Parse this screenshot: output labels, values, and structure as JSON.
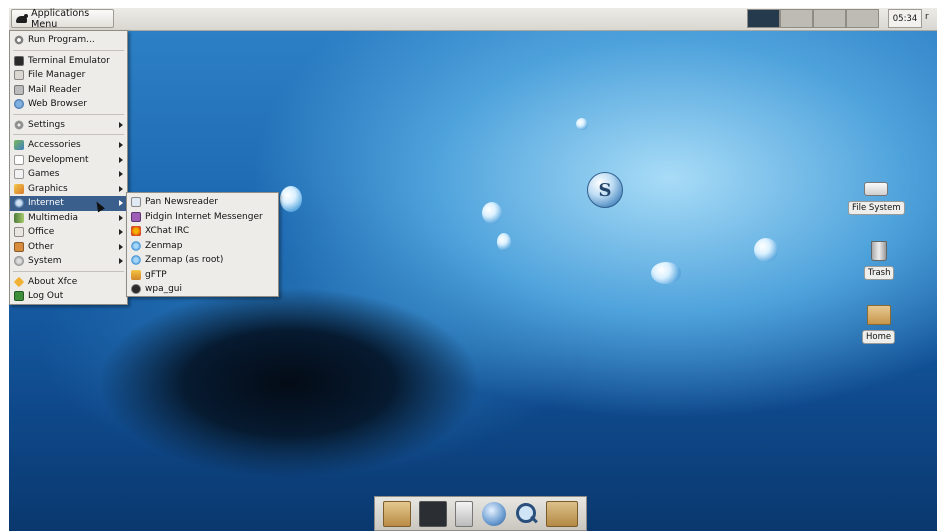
{
  "panel": {
    "apps_menu_label": "Applications Menu",
    "clock": "05:34",
    "user_clip": "r"
  },
  "main_menu": {
    "items": [
      {
        "label": "Run Program...",
        "icon": "run-icon"
      },
      {
        "label": "Terminal Emulator",
        "icon": "terminal-icon"
      },
      {
        "label": "File Manager",
        "icon": "file-manager-icon"
      },
      {
        "label": "Mail Reader",
        "icon": "mail-icon"
      },
      {
        "label": "Web Browser",
        "icon": "web-browser-icon"
      },
      {
        "label": "Settings",
        "icon": "settings-icon"
      },
      {
        "label": "Accessories",
        "icon": "accessories-icon"
      },
      {
        "label": "Development",
        "icon": "development-icon"
      },
      {
        "label": "Games",
        "icon": "games-icon"
      },
      {
        "label": "Graphics",
        "icon": "graphics-icon"
      },
      {
        "label": "Internet",
        "icon": "internet-icon",
        "highlighted": true
      },
      {
        "label": "Multimedia",
        "icon": "multimedia-icon"
      },
      {
        "label": "Office",
        "icon": "office-icon"
      },
      {
        "label": "Other",
        "icon": "other-icon"
      },
      {
        "label": "System",
        "icon": "system-icon"
      },
      {
        "label": "About Xfce",
        "icon": "about-icon"
      },
      {
        "label": "Log Out",
        "icon": "logout-icon"
      }
    ]
  },
  "internet_submenu": {
    "items": [
      {
        "label": "Pan Newsreader",
        "icon": "pan-icon"
      },
      {
        "label": "Pidgin Internet Messenger",
        "icon": "pidgin-icon"
      },
      {
        "label": "XChat IRC",
        "icon": "xchat-icon"
      },
      {
        "label": "Zenmap",
        "icon": "zenmap-icon"
      },
      {
        "label": "Zenmap (as root)",
        "icon": "zenmap-icon"
      },
      {
        "label": "gFTP",
        "icon": "gftp-icon"
      },
      {
        "label": "wpa_gui",
        "icon": "wpa-gui-icon"
      }
    ]
  },
  "desktop": {
    "badge_letter": "S",
    "icons": [
      {
        "label": "File System",
        "icon": "drive-icon"
      },
      {
        "label": "Trash",
        "icon": "trash-icon"
      },
      {
        "label": "Home",
        "icon": "home-folder-icon"
      }
    ]
  },
  "dock": {
    "launchers": [
      "home-folder-icon",
      "terminal-icon",
      "text-editor-icon",
      "web-browser-icon",
      "search-icon",
      "folder-icon"
    ]
  },
  "colors": {
    "panel": "#e2e0da",
    "menu_highlight": "#3a5f8c",
    "active_workspace": "#253a4d"
  }
}
